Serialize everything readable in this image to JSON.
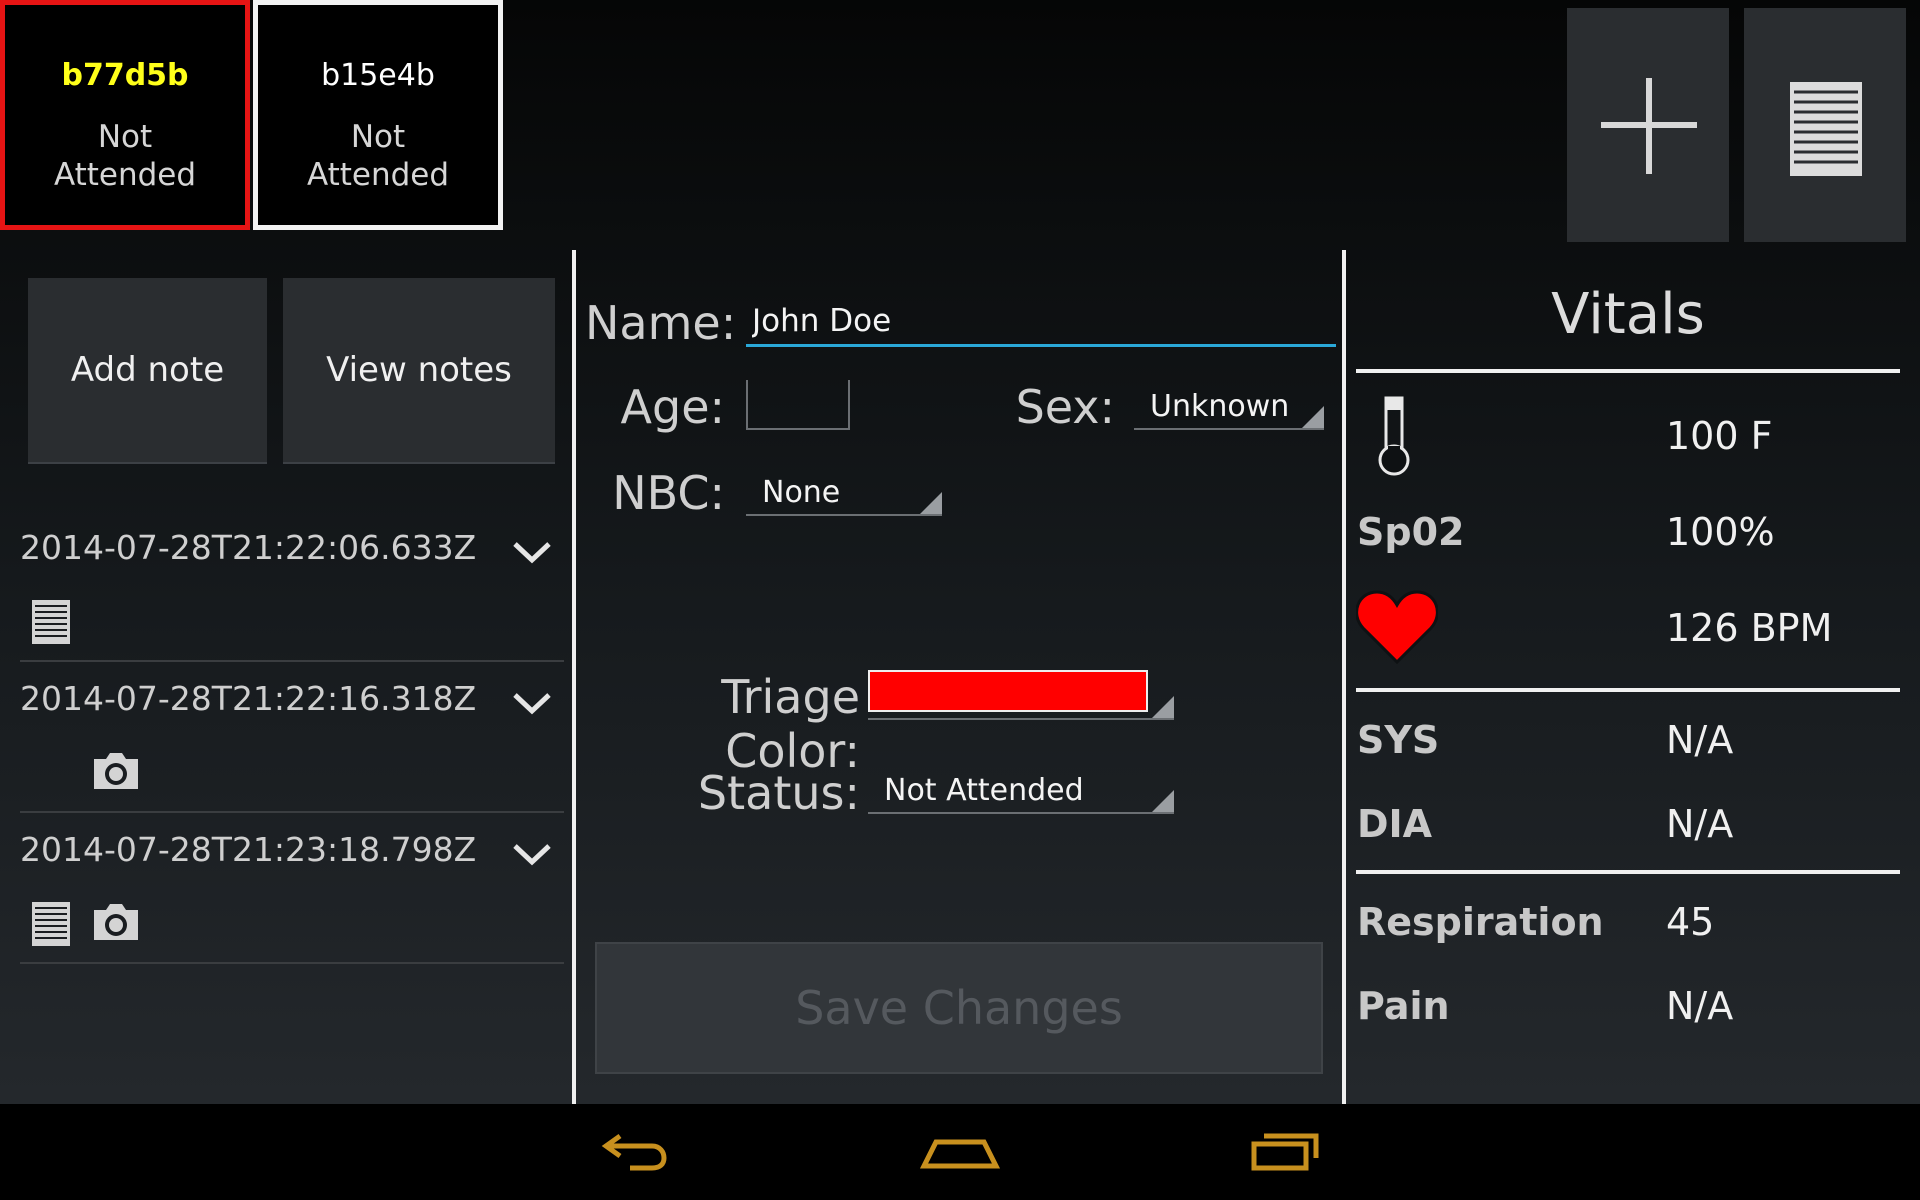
{
  "patients": [
    {
      "id": "b77d5b",
      "status": "Not Attended",
      "selected": true
    },
    {
      "id": "b15e4b",
      "status": "Not Attended",
      "selected": false
    }
  ],
  "toolbar": {
    "add_icon": "plus-icon",
    "list_icon": "list-icon"
  },
  "notes_panel": {
    "add_note_label": "Add note",
    "view_notes_label": "View notes",
    "items": [
      {
        "timestamp": "2014-07-28T21:22:06.633Z",
        "attachments": [
          "note-icon"
        ]
      },
      {
        "timestamp": "2014-07-28T21:22:16.318Z",
        "attachments": [
          "camera-icon"
        ]
      },
      {
        "timestamp": "2014-07-28T21:23:18.798Z",
        "attachments": [
          "note-icon",
          "camera-icon"
        ]
      }
    ]
  },
  "form": {
    "name_label": "Name:",
    "name_value": "John Doe",
    "age_label": "Age:",
    "age_value": "",
    "sex_label": "Sex:",
    "sex_value": "Unknown",
    "nbc_label": "NBC:",
    "nbc_value": "None",
    "triage_label": "Triage Color:",
    "triage_color": "#ff0000",
    "status_label": "Status:",
    "status_value": "Not Attended",
    "save_label": "Save Changes"
  },
  "vitals": {
    "title": "Vitals",
    "temperature": {
      "icon": "thermometer-icon",
      "value": "100 F"
    },
    "spo2": {
      "label": "Sp02",
      "value": "100%"
    },
    "heart_rate": {
      "icon": "heart-icon",
      "value": "126 BPM"
    },
    "sys": {
      "label": "SYS",
      "value": "N/A"
    },
    "dia": {
      "label": "DIA",
      "value": "N/A"
    },
    "respiration": {
      "label": "Respiration",
      "value": "45"
    },
    "pain": {
      "label": "Pain",
      "value": "N/A"
    }
  },
  "colors": {
    "selected_border": "#e61414",
    "selected_id": "#ffff1a",
    "accent": "#2aa8d8",
    "heart": "#ff0000",
    "nav_icons": "#c8901e"
  },
  "nav": {
    "back_icon": "back-icon",
    "home_icon": "home-icon",
    "recents_icon": "recents-icon"
  }
}
